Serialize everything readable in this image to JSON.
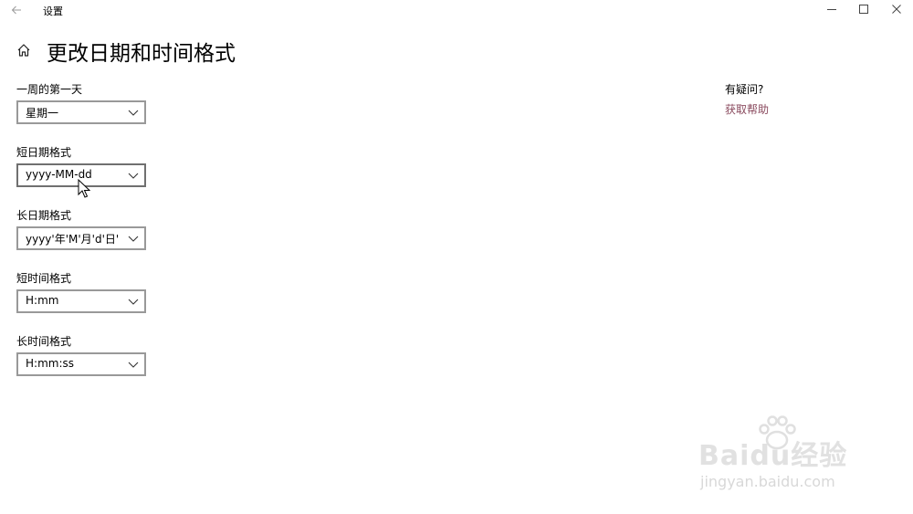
{
  "window": {
    "title": "设置",
    "controls": [
      "minimize",
      "maximize",
      "close"
    ]
  },
  "page": {
    "title": "更改日期和时间格式"
  },
  "fields": [
    {
      "label": "一周的第一天",
      "value": "星期一"
    },
    {
      "label": "短日期格式",
      "value": "yyyy-MM-dd"
    },
    {
      "label": "长日期格式",
      "value": "yyyy'年'M'月'd'日'"
    },
    {
      "label": "短时间格式",
      "value": "H:mm"
    },
    {
      "label": "长时间格式",
      "value": "H:mm:ss"
    }
  ],
  "help": {
    "title": "有疑问?",
    "link": "获取帮助"
  },
  "watermark": {
    "brand": "Baidu经验",
    "url": "jingyan.baidu.com"
  },
  "colors": {
    "link": "#8a4a5e",
    "combo_border": "#999999"
  }
}
